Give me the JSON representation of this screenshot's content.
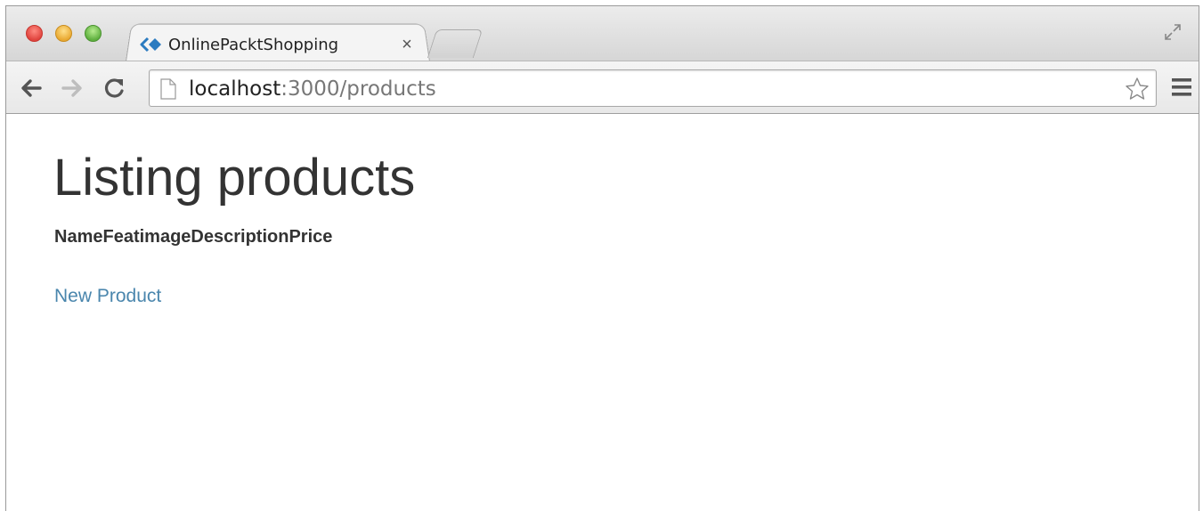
{
  "browser": {
    "tab": {
      "title": "OnlinePacktShopping",
      "close_label": "×"
    },
    "address_bar": {
      "host": "localhost",
      "path": ":3000/products"
    },
    "accent_colors": {
      "favicon": "#2b7bc0",
      "link": "#4a86ad",
      "text": "#333333"
    }
  },
  "page": {
    "title": "Listing products",
    "table": {
      "columns": [
        "Name",
        "Featimage",
        "Description",
        "Price"
      ]
    },
    "new_link_label": "New Product"
  }
}
